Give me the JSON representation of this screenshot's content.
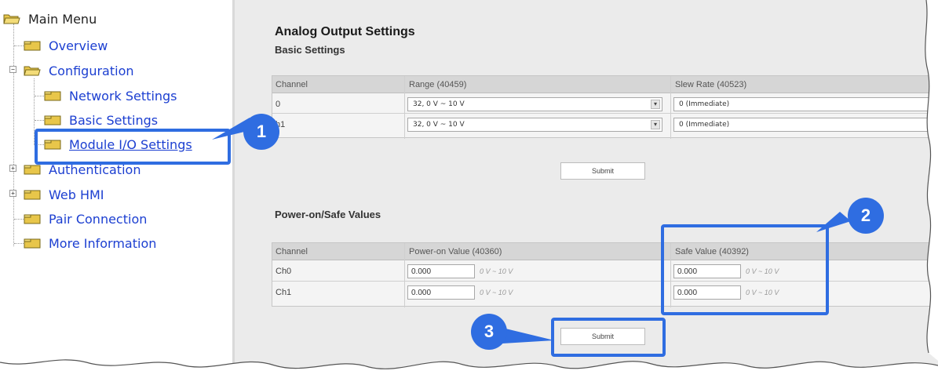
{
  "sidebar": {
    "root_label": "Main Menu",
    "items": [
      {
        "label": "Overview"
      },
      {
        "label": "Configuration"
      },
      {
        "label": "Network Settings"
      },
      {
        "label": "Basic Settings"
      },
      {
        "label": "Module I/O Settings"
      },
      {
        "label": "Authentication"
      },
      {
        "label": "Web HMI"
      },
      {
        "label": "Pair Connection"
      },
      {
        "label": "More Information"
      }
    ]
  },
  "main": {
    "title": "Analog Output Settings",
    "subtitle": "Basic Settings",
    "basic_table": {
      "headers": [
        "Channel",
        "Range (40459)",
        "Slew Rate (40523)"
      ],
      "rows": [
        {
          "channel": "0",
          "range": "32, 0 V ~ 10 V",
          "slew": "0 (Immediate)"
        },
        {
          "channel": "h1",
          "range": "32, 0 V ~ 10 V",
          "slew": "0 (Immediate)"
        }
      ]
    },
    "submit_label": "Submit",
    "power_section_title": "Power-on/Safe Values",
    "power_table": {
      "headers": [
        "Channel",
        "Power-on Value (40360)",
        "Safe Value (40392)"
      ],
      "rows": [
        {
          "channel": "Ch0",
          "power_on": "0.000",
          "power_hint": "0 V ~ 10 V",
          "safe": "0.000",
          "safe_hint": "0 V ~ 10 V"
        },
        {
          "channel": "Ch1",
          "power_on": "0.000",
          "power_hint": "0 V ~ 10 V",
          "safe": "0.000",
          "safe_hint": "0 V ~ 10 V"
        }
      ]
    },
    "submit2_label": "Submit"
  },
  "callouts": [
    {
      "number": "1"
    },
    {
      "number": "2"
    },
    {
      "number": "3"
    }
  ],
  "colors": {
    "accent": "#2f6de1",
    "link": "#1c3fd1",
    "folder": "#e8c64a"
  }
}
